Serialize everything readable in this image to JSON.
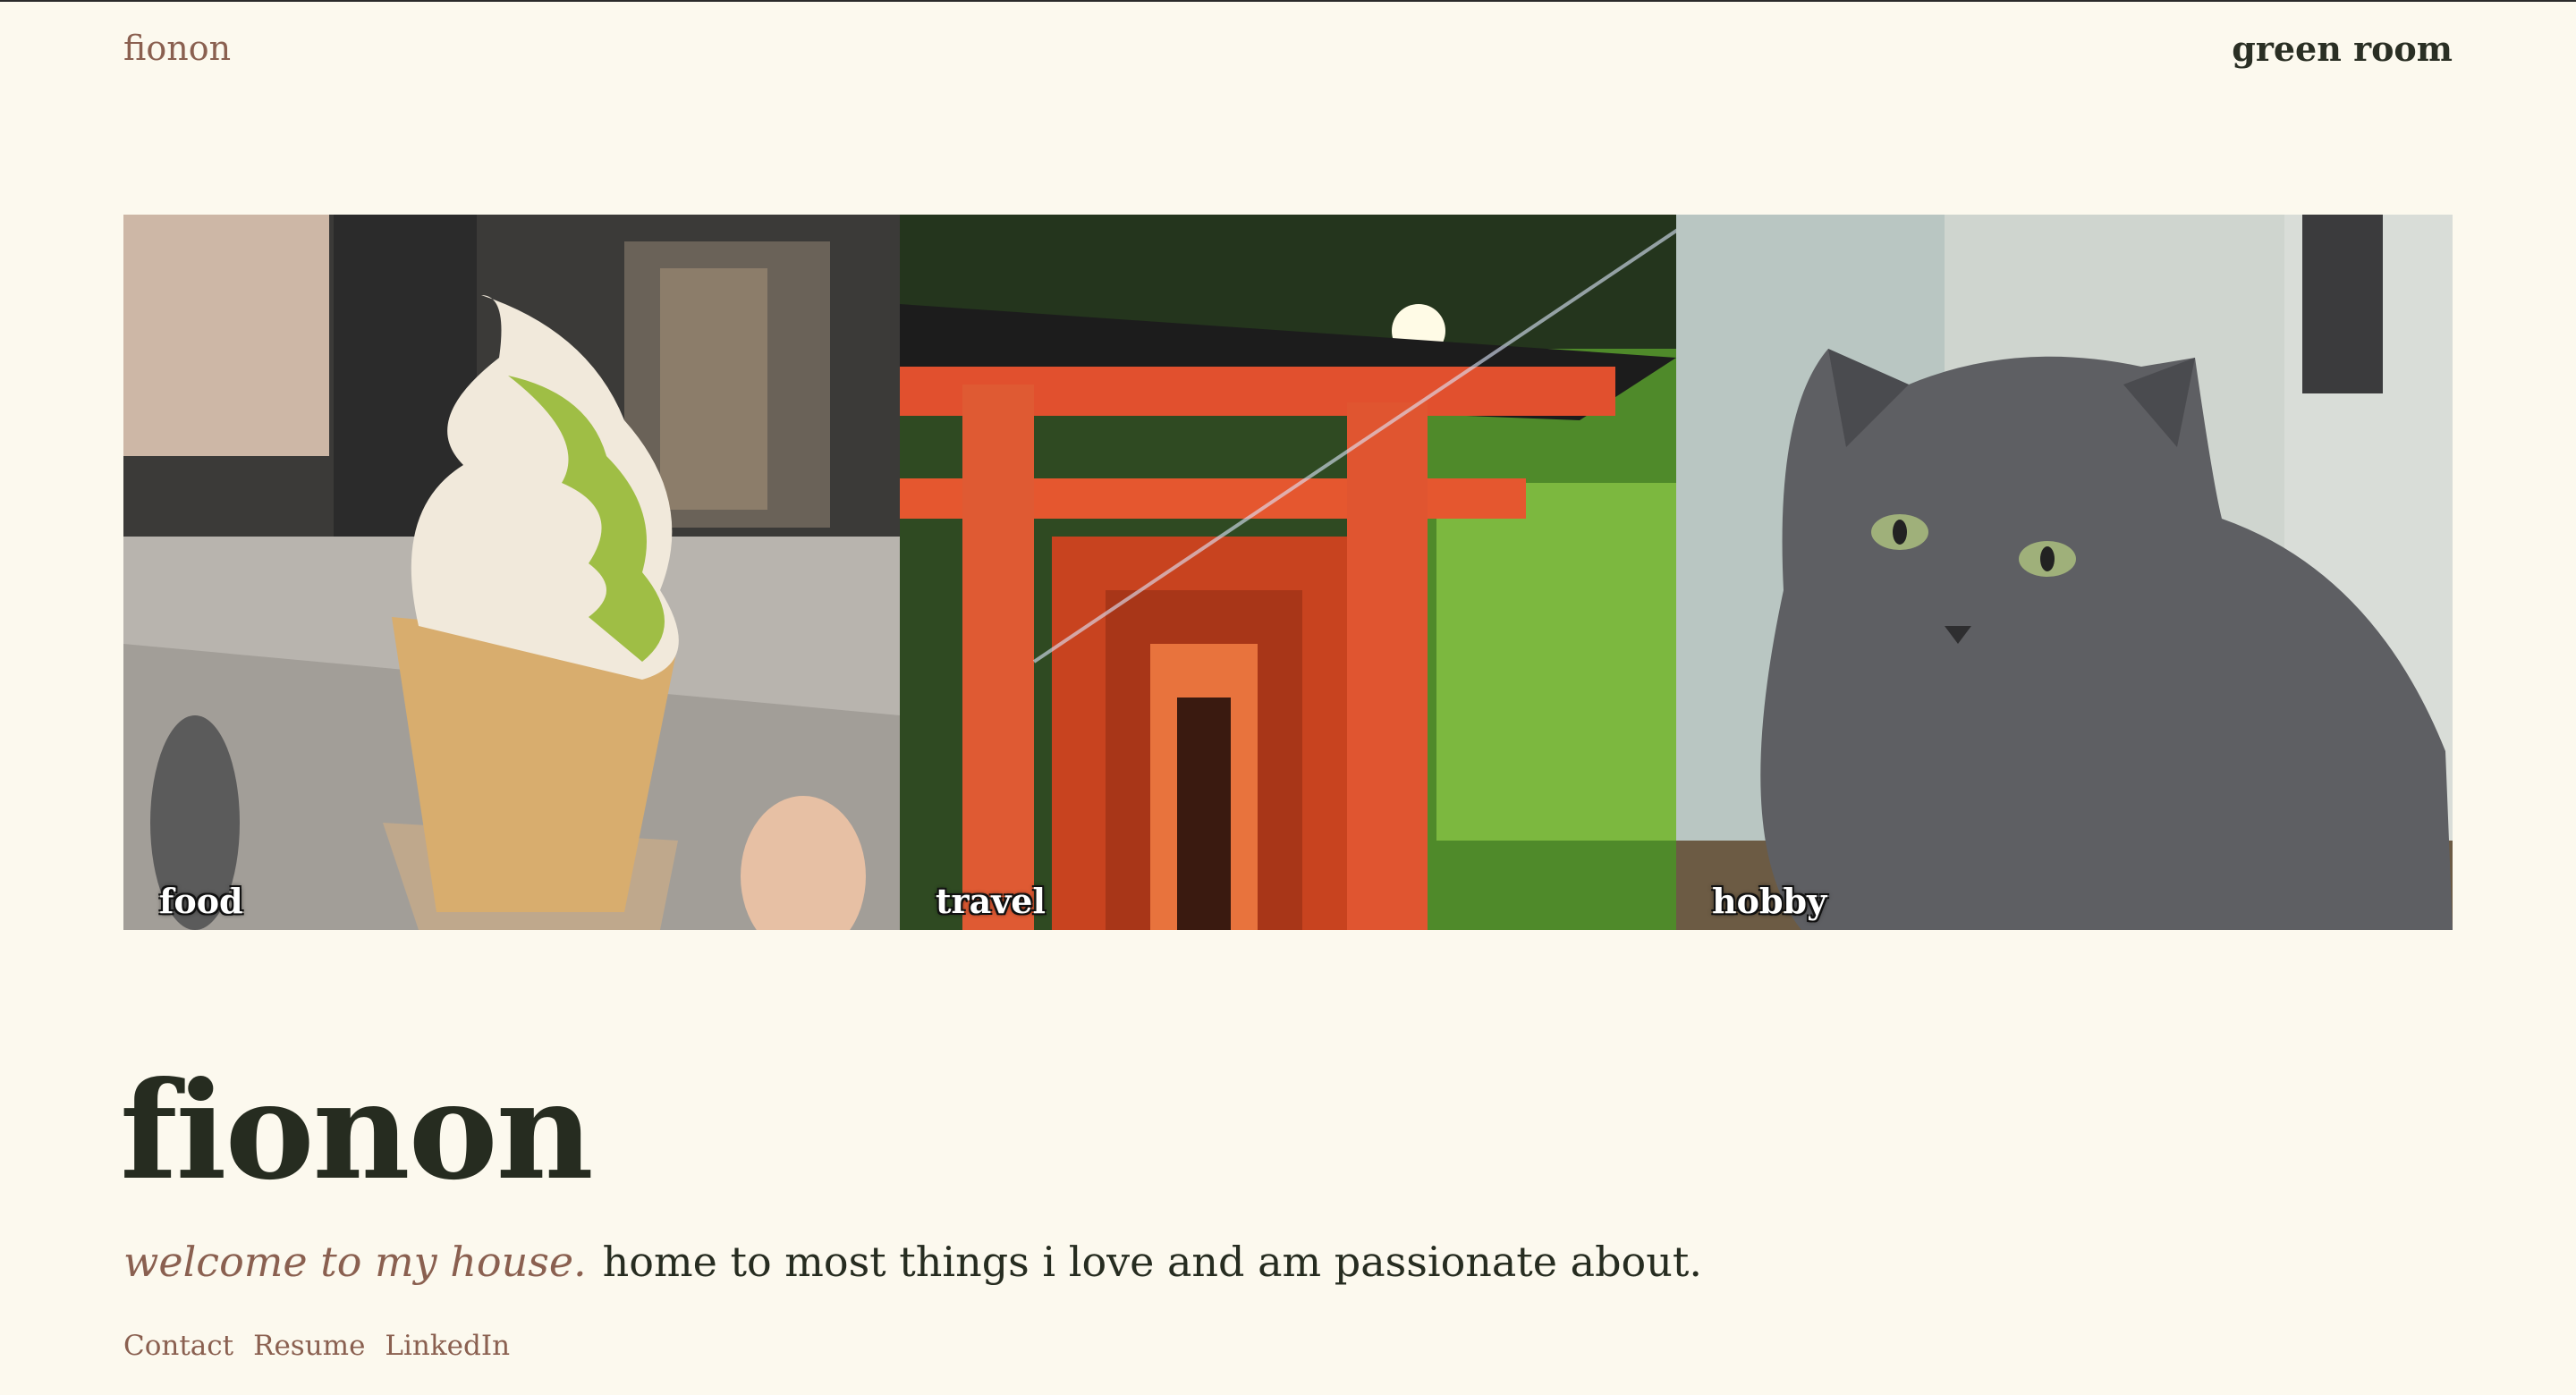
{
  "header": {
    "brand": "fionon",
    "nav_link": "green room"
  },
  "gallery": [
    {
      "label": "food",
      "image": "matcha-vanilla-soft-serve-cone"
    },
    {
      "label": "travel",
      "image": "red-torii-gates-shrine"
    },
    {
      "label": "hobby",
      "image": "gray-cat"
    }
  ],
  "hero": {
    "title": "fionon",
    "tagline_emphasis": "welcome to my house.",
    "tagline_rest": "home to most things i love and am passionate about."
  },
  "links": [
    "Contact",
    "Resume",
    "LinkedIn"
  ],
  "colors": {
    "background": "#fcf9ee",
    "accent": "#8a6050",
    "text": "#262c20"
  }
}
